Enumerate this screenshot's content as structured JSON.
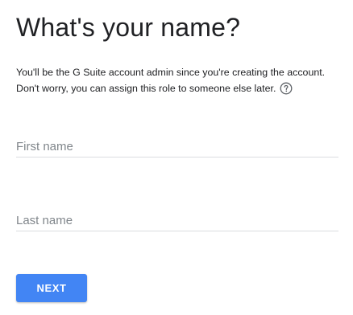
{
  "heading": "What's your name?",
  "description": {
    "line1": "You'll be the G Suite account admin since you're creating the account.",
    "line2": "Don't worry, you can assign this role to someone else later."
  },
  "help_icon": "help-circle-icon",
  "form": {
    "first_name": {
      "value": "",
      "placeholder": "First name"
    },
    "last_name": {
      "value": "",
      "placeholder": "Last name"
    }
  },
  "next_button": "NEXT",
  "colors": {
    "accent": "#4285f4",
    "text": "#202124",
    "placeholder": "#80868b",
    "underline": "#dadce0"
  }
}
